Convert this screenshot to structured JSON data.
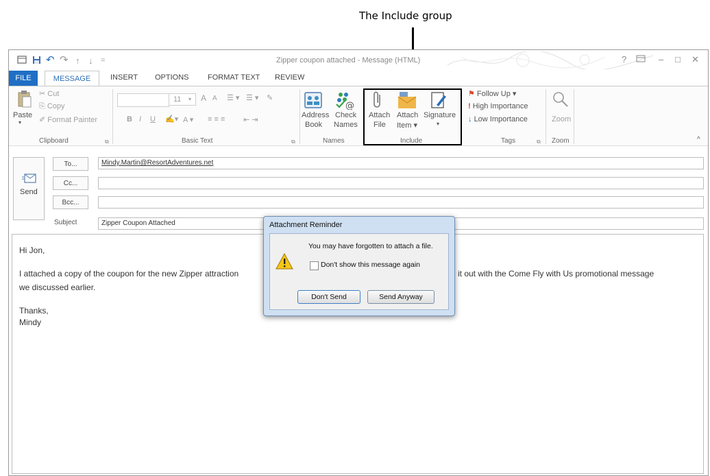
{
  "callout": {
    "label": "The Include group"
  },
  "window": {
    "title": "Zipper coupon attached - Message (HTML)",
    "help_glyph": "?",
    "minimize_glyph": "–",
    "restore_glyph": "□",
    "close_glyph": "✕"
  },
  "quick_access": {
    "undo_glyph": "↶",
    "redo_glyph": "↷",
    "up_glyph": "↑",
    "down_glyph": "↓",
    "customize_glyph": "="
  },
  "tabs": [
    "FILE",
    "MESSAGE",
    "INSERT",
    "OPTIONS",
    "FORMAT TEXT",
    "REVIEW"
  ],
  "ribbon": {
    "clipboard": {
      "paste": "Paste",
      "cut": "Cut",
      "copy": "Copy",
      "format_painter": "Format Painter",
      "label": "Clipboard"
    },
    "basic_text": {
      "font_size": "11",
      "grow": "A",
      "shrink": "A",
      "bold": "B",
      "italic": "I",
      "underline": "U",
      "font_color": "A",
      "label": "Basic Text"
    },
    "names": {
      "address_book_1": "Address",
      "address_book_2": "Book",
      "check_names_1": "Check",
      "check_names_2": "Names",
      "label": "Names"
    },
    "include": {
      "attach_file_1": "Attach",
      "attach_file_2": "File",
      "attach_item_1": "Attach",
      "attach_item_2": "Item ▾",
      "signature_1": "Signature",
      "signature_2": "▾",
      "label": "Include"
    },
    "tags": {
      "follow_up": "Follow Up ▾",
      "high_importance": "High Importance",
      "low_importance": "Low Importance",
      "label": "Tags"
    },
    "zoom": {
      "zoom": "Zoom",
      "label": "Zoom"
    },
    "collapse_glyph": "^"
  },
  "compose": {
    "send_label": "Send",
    "to_label": "To...",
    "to_value": "Mindy.Martin@ResortAdventures.net",
    "cc_label": "Cc...",
    "bcc_label": "Bcc...",
    "subject_label": "Subject",
    "subject_value": "Zipper Coupon Attached"
  },
  "body": {
    "greeting": "Hi Jon,",
    "para1_left": "I attached a copy of the coupon for the new Zipper attraction",
    "para1_right": "it out with the Come Fly with Us promotional message",
    "para2": "we discussed earlier.",
    "signoff": "Thanks,",
    "name": "Mindy"
  },
  "dialog": {
    "title": "Attachment Reminder",
    "message": "You may have forgotten to attach a file.",
    "checkbox_label": "Don't show this message again",
    "dont_send": "Don't Send",
    "send_anyway": "Send Anyway"
  }
}
